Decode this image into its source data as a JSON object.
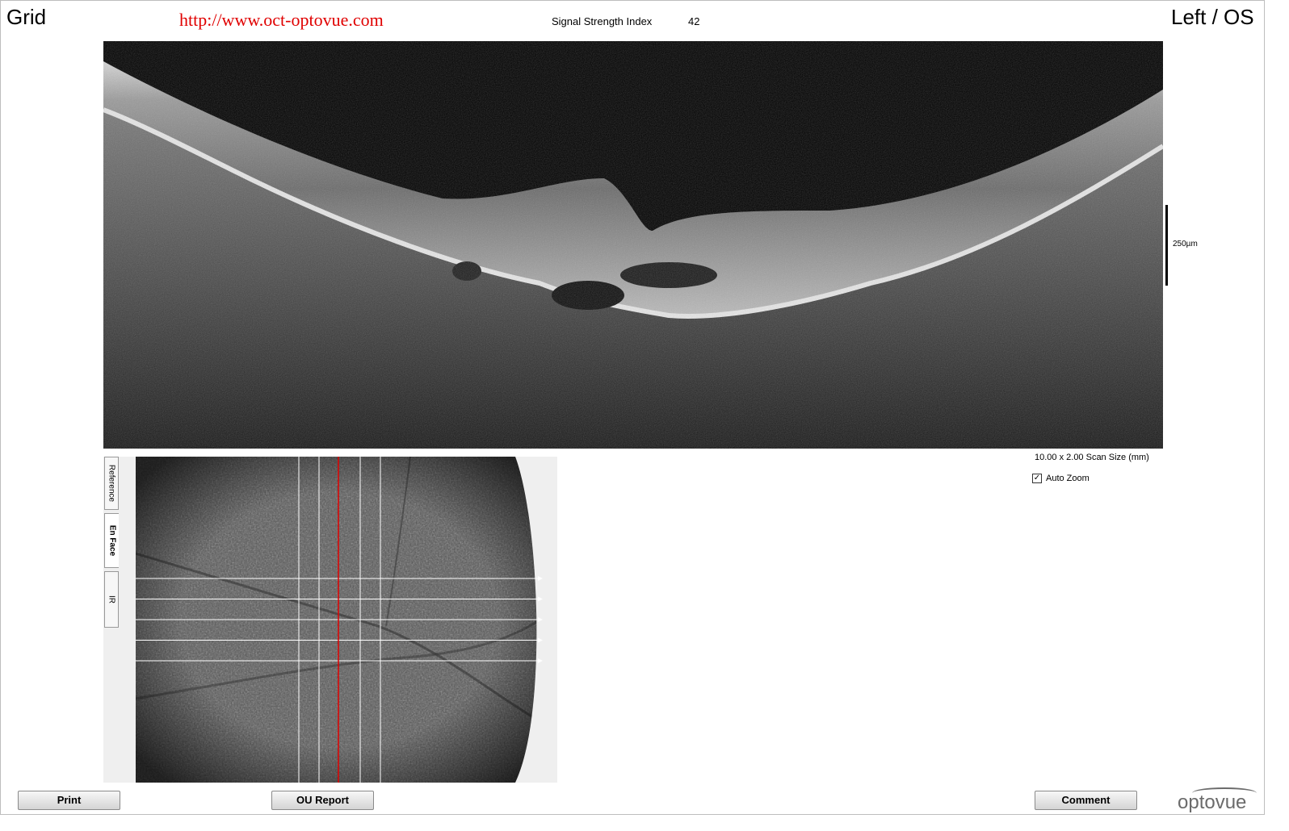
{
  "header": {
    "scan_type": "Grid",
    "url": "http://www.oct-optovue.com",
    "signal_strength_label": "Signal Strength Index",
    "signal_strength_value": "42",
    "eye": "Left / OS"
  },
  "bscan": {
    "scale_label": "250µm",
    "scan_size": "10.00 x 2.00 Scan Size (mm)",
    "auto_zoom_label": "Auto Zoom",
    "auto_zoom_checked": true
  },
  "enface": {
    "tabs": [
      {
        "label": "Reference",
        "active": false
      },
      {
        "label": "En Face",
        "active": true
      },
      {
        "label": "IR",
        "active": false
      }
    ],
    "horizontal_scan_lines": 5,
    "vertical_scan_lines": 4,
    "selected_line_color": "#e00000"
  },
  "footer": {
    "print_label": "Print",
    "ou_report_label": "OU Report",
    "comment_label": "Comment",
    "logo": "optovue"
  },
  "colors": {
    "url_red": "#e00000",
    "panel_bg": "#efefef"
  }
}
